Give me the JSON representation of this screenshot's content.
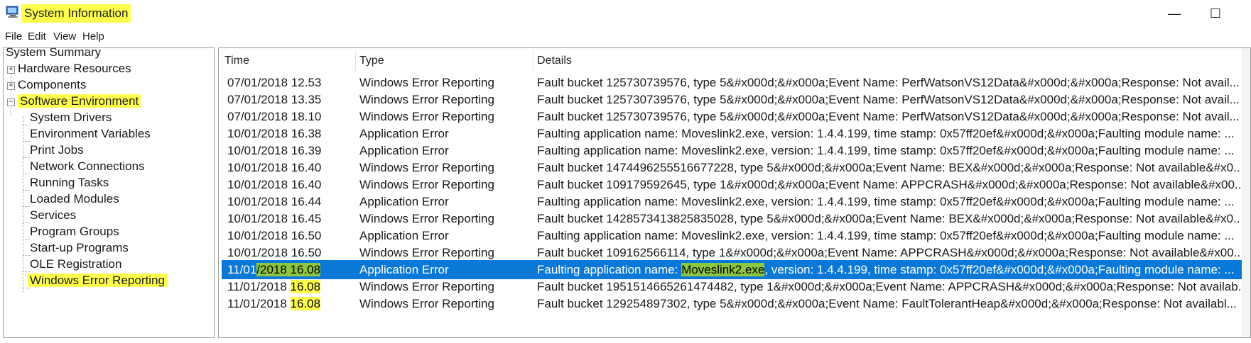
{
  "window": {
    "title": "System Information",
    "minimize_label": "—",
    "maximize_label": "☐",
    "highlight_color": "#ffff4d",
    "selection_color": "#0a78d7",
    "annotation_green": "#8dc63f"
  },
  "menu": [
    "File",
    "Edit",
    "View",
    "Help"
  ],
  "tree": {
    "root": "System Summary",
    "hardware": "Hardware Resources",
    "components": "Components",
    "software": "Software Environment",
    "children": [
      "System Drivers",
      "Environment Variables",
      "Print Jobs",
      "Network Connections",
      "Running Tasks",
      "Loaded Modules",
      "Services",
      "Program Groups",
      "Start-up Programs",
      "OLE Registration",
      "Windows Error Reporting"
    ],
    "expand_symbol": "+",
    "collapse_symbol": "−"
  },
  "table": {
    "headers": [
      "Time",
      "Type",
      "Details"
    ],
    "rows": [
      {
        "time": "07/01/2018 12.53",
        "type": "Windows Error Reporting",
        "details": "Fault bucket 125730739576, type 5&#x000d;&#x000a;Event Name: PerfWatsonVS12Data&#x000d;&#x000a;Response: Not avail..."
      },
      {
        "time": "07/01/2018 13.35",
        "type": "Windows Error Reporting",
        "details": "Fault bucket 125730739576, type 5&#x000d;&#x000a;Event Name: PerfWatsonVS12Data&#x000d;&#x000a;Response: Not avail..."
      },
      {
        "time": "07/01/2018 18.10",
        "type": "Windows Error Reporting",
        "details": "Fault bucket 125730739576, type 5&#x000d;&#x000a;Event Name: PerfWatsonVS12Data&#x000d;&#x000a;Response: Not avail..."
      },
      {
        "time": "10/01/2018 16.38",
        "type": "Application Error",
        "details": "Faulting application name: Moveslink2.exe, version: 1.4.4.199, time stamp: 0x57ff20ef&#x000d;&#x000a;Faulting module name: ..."
      },
      {
        "time": "10/01/2018 16.39",
        "type": "Application Error",
        "details": "Faulting application name: Moveslink2.exe, version: 1.4.4.199, time stamp: 0x57ff20ef&#x000d;&#x000a;Faulting module name: ..."
      },
      {
        "time": "10/01/2018 16.40",
        "type": "Windows Error Reporting",
        "details": "Fault bucket 1474496255516677228, type 5&#x000d;&#x000a;Event Name: BEX&#x000d;&#x000a;Response: Not available&#x0..."
      },
      {
        "time": "10/01/2018 16.40",
        "type": "Windows Error Reporting",
        "details": "Fault bucket 109179592645, type 1&#x000d;&#x000a;Event Name: APPCRASH&#x000d;&#x000a;Response: Not available&#x00..."
      },
      {
        "time": "10/01/2018 16.44",
        "type": "Application Error",
        "details": "Faulting application name: Moveslink2.exe, version: 1.4.4.199, time stamp: 0x57ff20ef&#x000d;&#x000a;Faulting module name: ..."
      },
      {
        "time": "10/01/2018 16.45",
        "type": "Windows Error Reporting",
        "details": "Fault bucket 1428573413825835028, type 5&#x000d;&#x000a;Event Name: BEX&#x000d;&#x000a;Response: Not available&#x0..."
      },
      {
        "time": "10/01/2018 16.50",
        "type": "Application Error",
        "details": "Faulting application name: Moveslink2.exe, version: 1.4.4.199, time stamp: 0x57ff20ef&#x000d;&#x000a;Faulting module name: ..."
      },
      {
        "time": "10/01/2018 16.50",
        "type": "Windows Error Reporting",
        "details": "Fault bucket 109162566114, type 1&#x000d;&#x000a;Event Name: APPCRASH&#x000d;&#x000a;Response: Not available&#x00..."
      }
    ],
    "selected_row": {
      "time_prefix": "11/01",
      "time_date_rest": "/2018 16.08",
      "type": "Application Error",
      "details_prefix": "Faulting application name: ",
      "details_highlight": "Moveslink2.exe",
      "details_suffix": ", version: 1.4.4.199, time stamp: 0x57ff20ef&#x000d;&#x000a;Faulting module name: ..."
    },
    "tail_rows": [
      {
        "date": "11/01/2018 ",
        "clock": "16.08",
        "type": "Windows Error Reporting",
        "details": "Fault bucket 1951514665261474482, type 1&#x000d;&#x000a;Event Name: APPCRASH&#x000d;&#x000a;Response: Not availab..."
      },
      {
        "date": "11/01/2018 ",
        "clock": "16.08",
        "type": "Windows Error Reporting",
        "details": "Fault bucket 129254897302, type 5&#x000d;&#x000a;Event Name: FaultTolerantHeap&#x000d;&#x000a;Response: Not availabl..."
      }
    ]
  }
}
